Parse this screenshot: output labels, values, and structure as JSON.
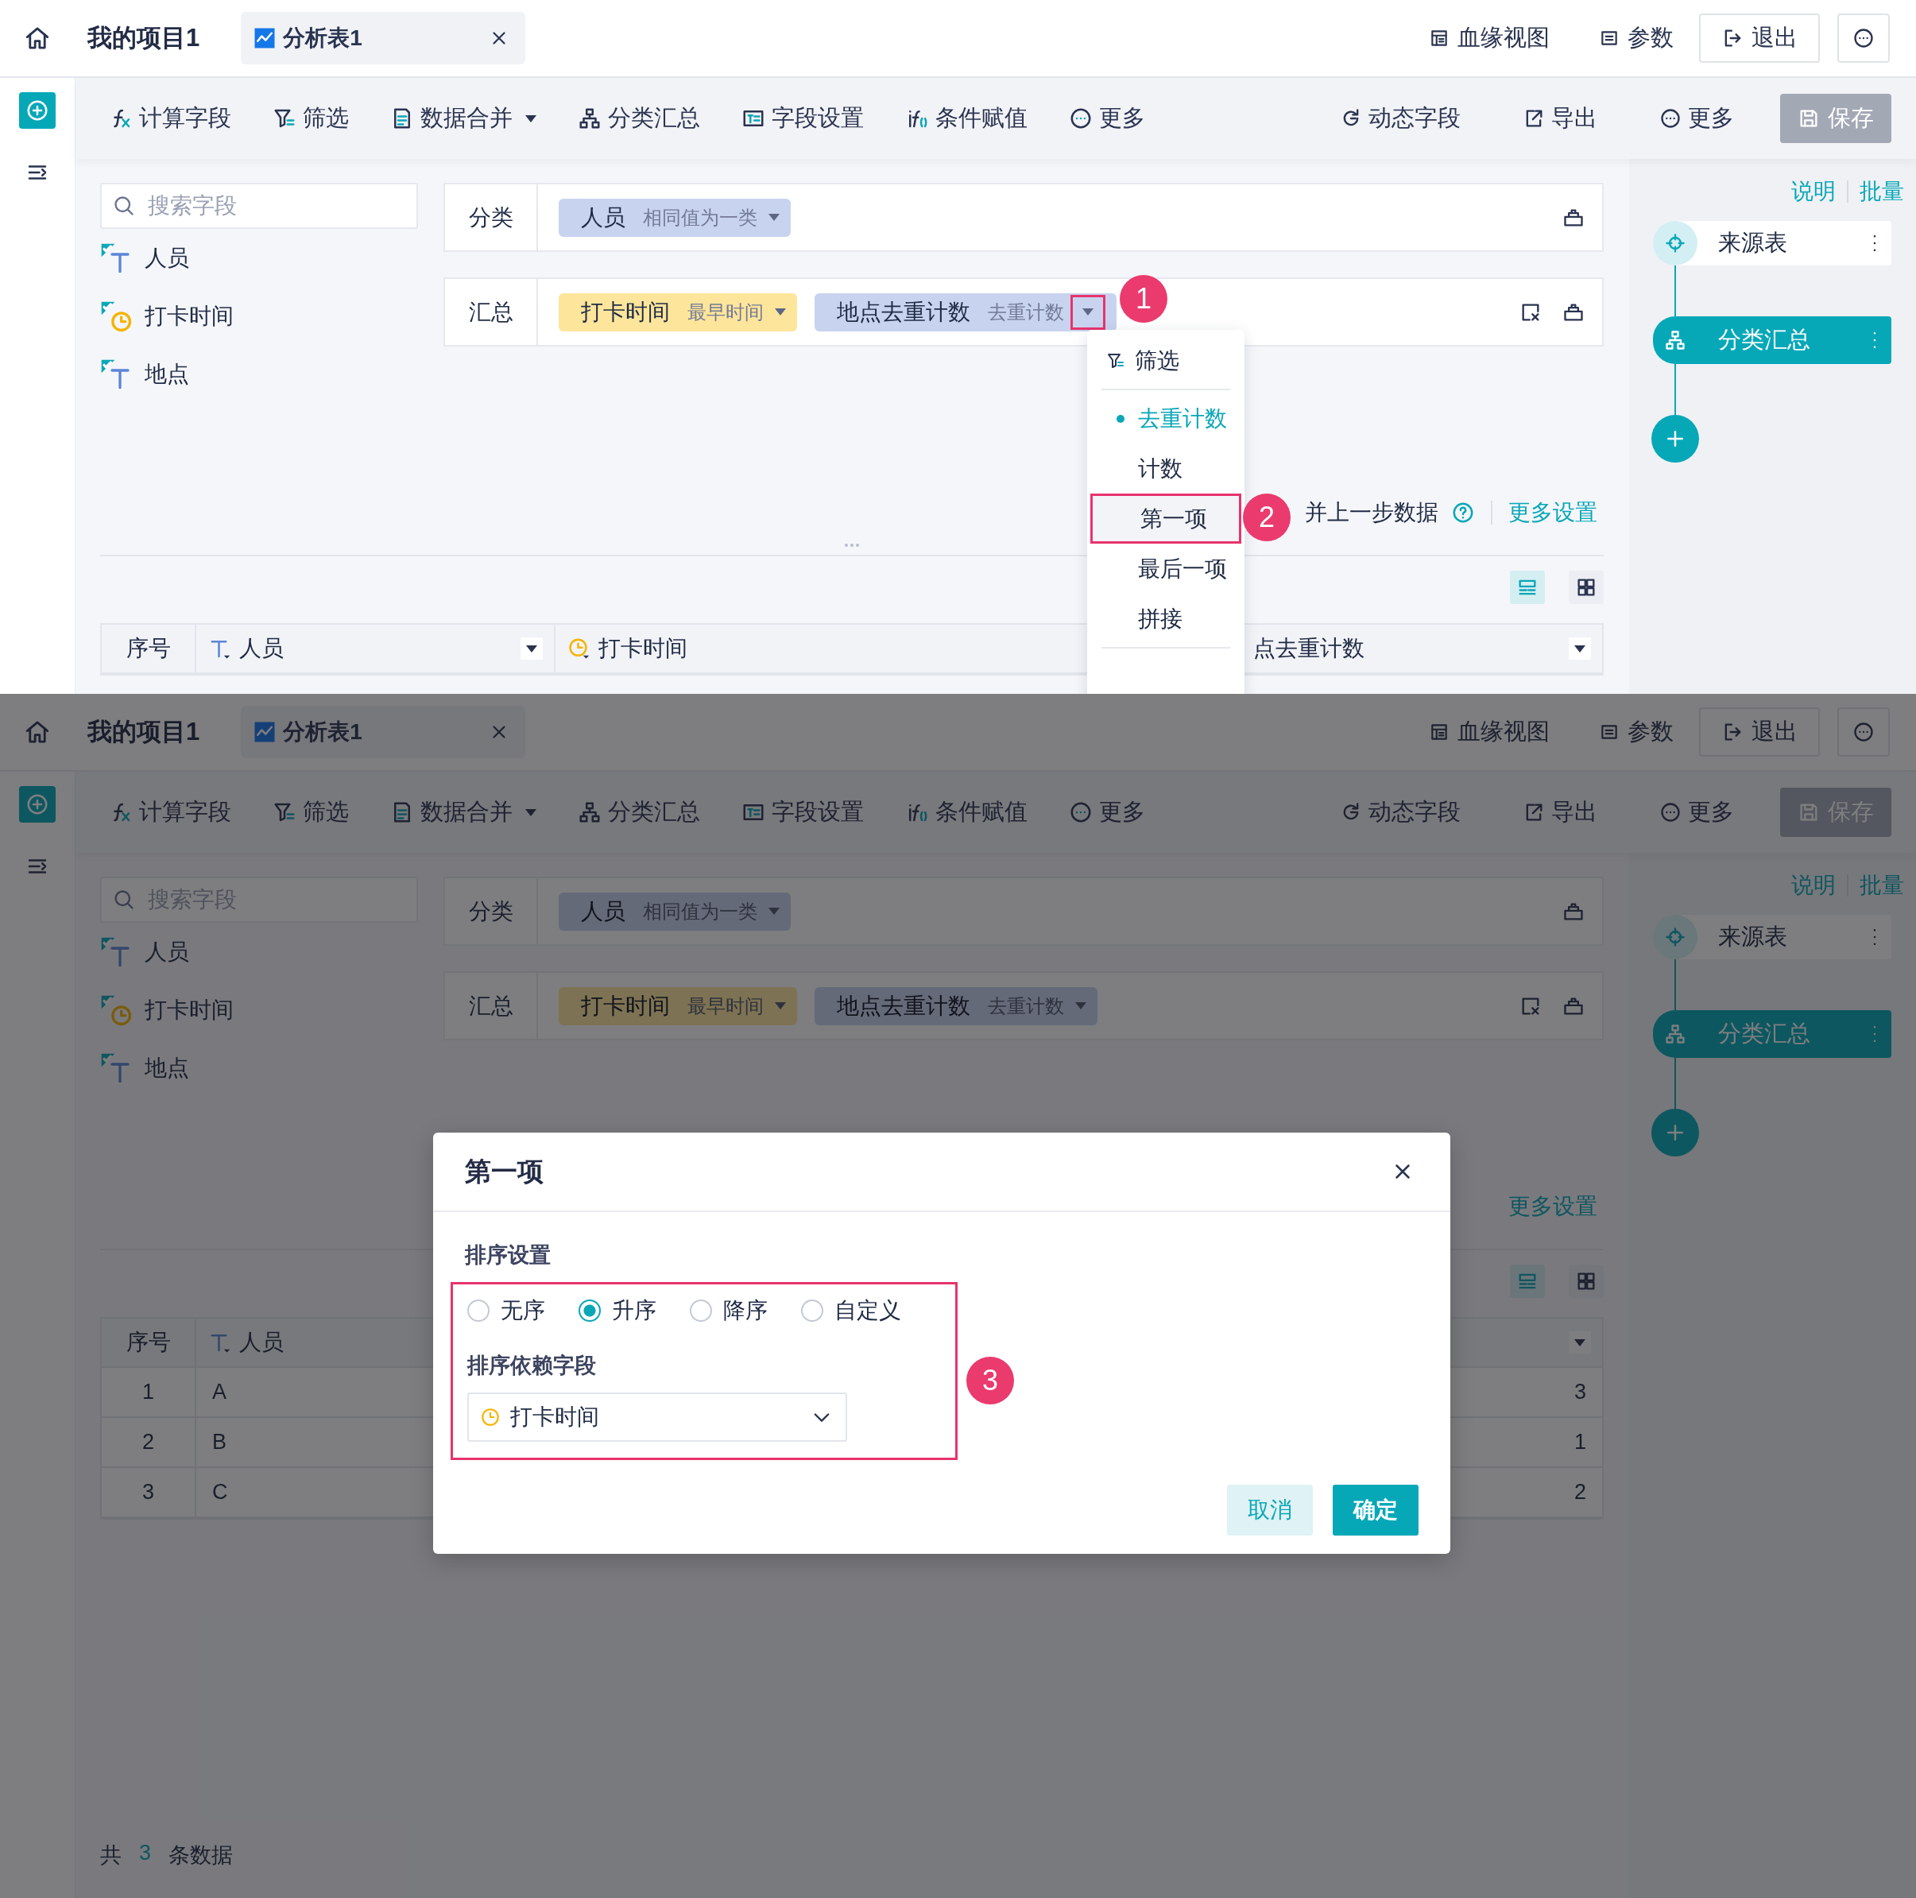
{
  "screens": [
    {
      "kind": "dropdown",
      "header": {
        "project": "我的项目1",
        "tab": "分析表1",
        "links": [
          "血缘视图",
          "参数"
        ],
        "exit": "退出"
      },
      "toolbar": {
        "left": [
          {
            "label": "计算字段",
            "dropdown": false
          },
          {
            "label": "筛选",
            "dropdown": false
          },
          {
            "label": "数据合并",
            "dropdown": true
          },
          {
            "label": "分类汇总",
            "dropdown": false
          },
          {
            "label": "字段设置",
            "dropdown": false
          },
          {
            "label": "条件赋值",
            "dropdown": false
          },
          {
            "label": "更多",
            "dropdown": false
          }
        ],
        "right": [
          "动态字段",
          "导出",
          "更多"
        ],
        "save": {
          "label": "保存",
          "disabled": true
        }
      },
      "search": {
        "placeholder": "搜索字段"
      },
      "fields": [
        {
          "name": "人员",
          "kind": "text"
        },
        {
          "name": "打卡时间",
          "kind": "time"
        },
        {
          "name": "地点",
          "kind": "text"
        }
      ],
      "drop_rows": [
        {
          "label": "分类",
          "chips": [
            {
              "name": "人员",
              "method": "相同值为一类",
              "color": "#c8d3ef"
            }
          ]
        },
        {
          "label": "汇总",
          "chips": [
            {
              "name": "打卡时间",
              "method": "最早时间",
              "color": "#fde59b"
            },
            {
              "name": "地点去重计数",
              "method": "去重计数",
              "color": "#c8d3ef",
              "callout": "1"
            }
          ]
        }
      ],
      "options": {
        "merge_label": "并上一步数据",
        "more_settings": "更多设置"
      },
      "view_toggles": [
        {
          "selected": true
        },
        {
          "selected": false
        }
      ],
      "table": {
        "columns": [
          {
            "label": "序号",
            "menu": false
          },
          {
            "label": "人员",
            "kind": "text",
            "menu": true
          },
          {
            "label": "打卡时间",
            "kind": "time"
          },
          {
            "label": "点去重计数",
            "menu": true
          }
        ]
      },
      "flow": {
        "links": [
          "说明",
          "批量"
        ],
        "nodes": [
          {
            "label": "来源表",
            "selected": false
          },
          {
            "label": "分类汇总",
            "selected": true
          }
        ]
      },
      "dropdown": {
        "items": [
          {
            "label": "筛选",
            "kind": "action",
            "selected": false
          },
          {
            "label": "去重计数",
            "kind": "option",
            "selected": true
          },
          {
            "label": "计数",
            "kind": "option",
            "selected": false
          },
          {
            "label": "第一项",
            "kind": "option",
            "selected": false,
            "callout": "2"
          },
          {
            "label": "最后一项",
            "kind": "option",
            "selected": false
          },
          {
            "label": "拼接",
            "kind": "option",
            "selected": false
          }
        ]
      }
    },
    {
      "kind": "dialog",
      "header": {
        "project": "我的项目1",
        "tab": "分析表1",
        "links": [
          "血缘视图",
          "参数"
        ],
        "exit": "退出"
      },
      "toolbar": {
        "left": [
          {
            "label": "计算字段",
            "dropdown": false
          },
          {
            "label": "筛选",
            "dropdown": false
          },
          {
            "label": "数据合并",
            "dropdown": true
          },
          {
            "label": "分类汇总",
            "dropdown": false
          },
          {
            "label": "字段设置",
            "dropdown": false
          },
          {
            "label": "条件赋值",
            "dropdown": false
          },
          {
            "label": "更多",
            "dropdown": false
          }
        ],
        "right": [
          "动态字段",
          "导出",
          "更多"
        ],
        "save": {
          "label": "保存",
          "disabled": true
        }
      },
      "search": {
        "placeholder": "搜索字段"
      },
      "fields": [
        {
          "name": "人员",
          "kind": "text"
        },
        {
          "name": "打卡时间",
          "kind": "time"
        },
        {
          "name": "地点",
          "kind": "text"
        }
      ],
      "drop_rows": [
        {
          "label": "分类",
          "chips": [
            {
              "name": "人员",
              "method": "相同值为一类",
              "color": "#656a79"
            }
          ]
        },
        {
          "label": "汇总",
          "chips": [
            {
              "name": "打卡时间",
              "method": "最早时间",
              "color": "#7d7253"
            },
            {
              "name": "地点去重计数",
              "method": "去重计数",
              "color": "#656a79"
            }
          ]
        }
      ],
      "options": {
        "more_settings": "更多设置"
      },
      "view_toggles": [
        {
          "selected": true
        },
        {
          "selected": false
        }
      ],
      "table": {
        "columns": [
          {
            "label": "序号",
            "menu": false
          },
          {
            "label": "人员",
            "kind": "text"
          },
          {
            "menu": true
          }
        ],
        "rows": [
          [
            "1",
            "A",
            "3"
          ],
          [
            "2",
            "B",
            "1"
          ],
          [
            "3",
            "C",
            "2"
          ]
        ]
      },
      "footer": {
        "prefix": "共",
        "count": "3",
        "suffix": "条数据"
      },
      "flow": {
        "links": [
          "说明",
          "批量"
        ],
        "nodes": [
          {
            "label": "来源表",
            "selected": false
          },
          {
            "label": "分类汇总",
            "selected": true
          }
        ]
      },
      "dialog": {
        "title": "第一项",
        "sort_label": "排序设置",
        "sort_options": [
          {
            "label": "无序",
            "selected": false
          },
          {
            "label": "升序",
            "selected": true
          },
          {
            "label": "降序",
            "selected": false
          },
          {
            "label": "自定义",
            "selected": false
          }
        ],
        "field_label": "排序依赖字段",
        "field": {
          "value": "打卡时间",
          "kind": "time"
        },
        "callout": "3",
        "buttons": [
          {
            "label": "取消",
            "kind": "secondary"
          },
          {
            "label": "确定",
            "kind": "primary"
          }
        ]
      }
    }
  ]
}
